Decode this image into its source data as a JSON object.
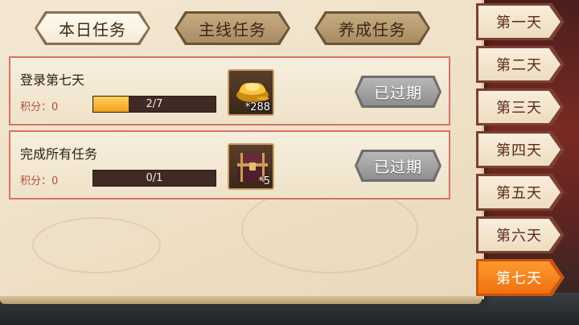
{
  "tabs": [
    {
      "label": "本日任务",
      "active": true
    },
    {
      "label": "主线任务",
      "active": false
    },
    {
      "label": "养成任务",
      "active": false
    }
  ],
  "tasks": [
    {
      "title": "登录第七天",
      "score": "积分：0",
      "progress_text": "2/7",
      "progress": 0.29,
      "reward_icon": "gold-ingot-icon",
      "reward_qty": "*288",
      "status": "已过期"
    },
    {
      "title": "完成所有任务",
      "score": "积分：0",
      "progress_text": "0/1",
      "progress": 0,
      "reward_icon": "treasure-chest-icon",
      "reward_qty": "*5",
      "status": "已过期"
    }
  ],
  "days": [
    {
      "label": "第一天",
      "active": false
    },
    {
      "label": "第二天",
      "active": false
    },
    {
      "label": "第三天",
      "active": false
    },
    {
      "label": "第四天",
      "active": false
    },
    {
      "label": "第五天",
      "active": false
    },
    {
      "label": "第六天",
      "active": false
    },
    {
      "label": "第七天",
      "active": true
    }
  ],
  "colors": {
    "active_day": "#f07010",
    "card_border": "#d47466",
    "progress_fill": "#f0a21e",
    "expired_button": "#9a9a9a"
  }
}
